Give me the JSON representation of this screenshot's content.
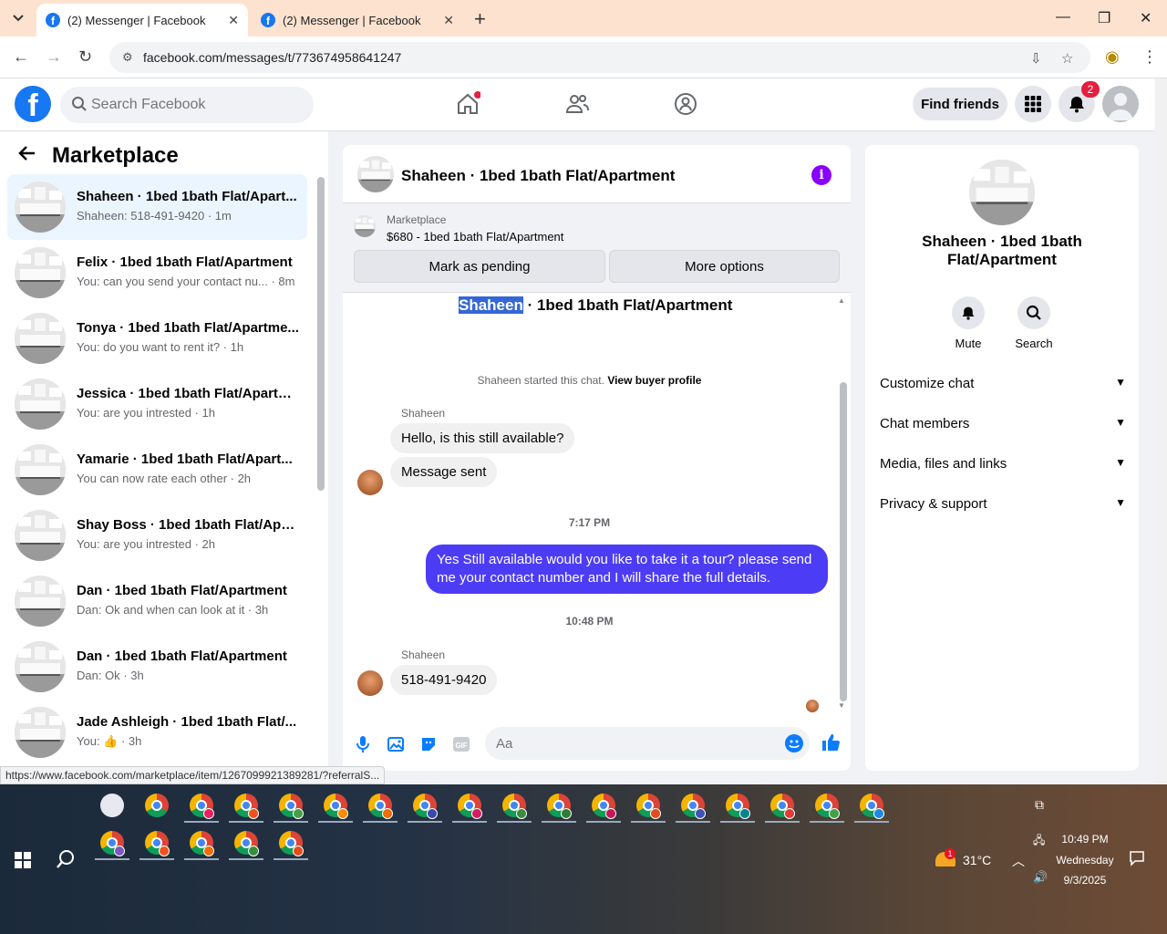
{
  "browser": {
    "tabs": [
      {
        "title": "(2) Messenger | Facebook"
      },
      {
        "title": "(2) Messenger | Facebook"
      }
    ],
    "url": "facebook.com/messages/t/773674958641247",
    "status_url": "https://www.facebook.com/marketplace/item/1267099921389281/?referralS..."
  },
  "fb": {
    "search_placeholder": "Search Facebook",
    "find_friends": "Find friends",
    "notification_count": "2"
  },
  "left": {
    "title": "Marketplace",
    "conversations": [
      {
        "name": "Shaheen · 1bed 1bath Flat/Apart...",
        "sub": "Shaheen: 518-491-9420 · 1m"
      },
      {
        "name": "Felix · 1bed 1bath Flat/Apartment",
        "sub": "You: can you send your contact nu... · 8m"
      },
      {
        "name": "Tonya · 1bed 1bath Flat/Apartme...",
        "sub": "You: do you want to rent it? · 1h"
      },
      {
        "name": "Jessica · 1bed 1bath Flat/Apartm...",
        "sub": "You: are you intrested · 1h"
      },
      {
        "name": "Yamarie · 1bed 1bath Flat/Apart...",
        "sub": "You can now rate each other · 2h"
      },
      {
        "name": "Shay Boss · 1bed 1bath Flat/Apar...",
        "sub": "You: are you intrested · 2h"
      },
      {
        "name": "Dan · 1bed 1bath Flat/Apartment",
        "sub": "Dan: Ok and when can look at it · 3h"
      },
      {
        "name": "Dan · 1bed 1bath Flat/Apartment",
        "sub": "Dan: Ok · 3h"
      },
      {
        "name": "Jade Ashleigh · 1bed 1bath Flat/...",
        "sub": "You: 👍 · 3h"
      }
    ]
  },
  "chat": {
    "title": "Shaheen · 1bed 1bath Flat/Apartment",
    "marketplace_label": "Marketplace",
    "listing": "$680 - 1bed 1bath Flat/Apartment",
    "mark_pending": "Mark as pending",
    "more_options": "More options",
    "intro_selected": "Shaheen",
    "intro_rest": " · 1bed 1bath Flat/Apartment",
    "started_text": "Shaheen started this chat.",
    "view_buyer": "View buyer profile",
    "sender1": "Shaheen",
    "msg1": "Hello, is this still available?",
    "msg2": "Message sent",
    "time1": "7:17 PM",
    "msg3": "Yes Still available would you like to take it a tour? please send me your contact number and I will share the full details.",
    "time2": "10:48 PM",
    "sender2": "Shaheen",
    "msg4": "518-491-9420",
    "composer_placeholder": "Aa"
  },
  "right": {
    "name": "Shaheen · 1bed 1bath Flat/Apartment",
    "mute": "Mute",
    "search": "Search",
    "rows": [
      "Customize chat",
      "Chat members",
      "Media, files and links",
      "Privacy & support"
    ]
  },
  "taskbar": {
    "temp": "31°C",
    "time": "10:49 PM",
    "day": "Wednesday",
    "date": "9/3/2025",
    "weather_badge": "1"
  }
}
